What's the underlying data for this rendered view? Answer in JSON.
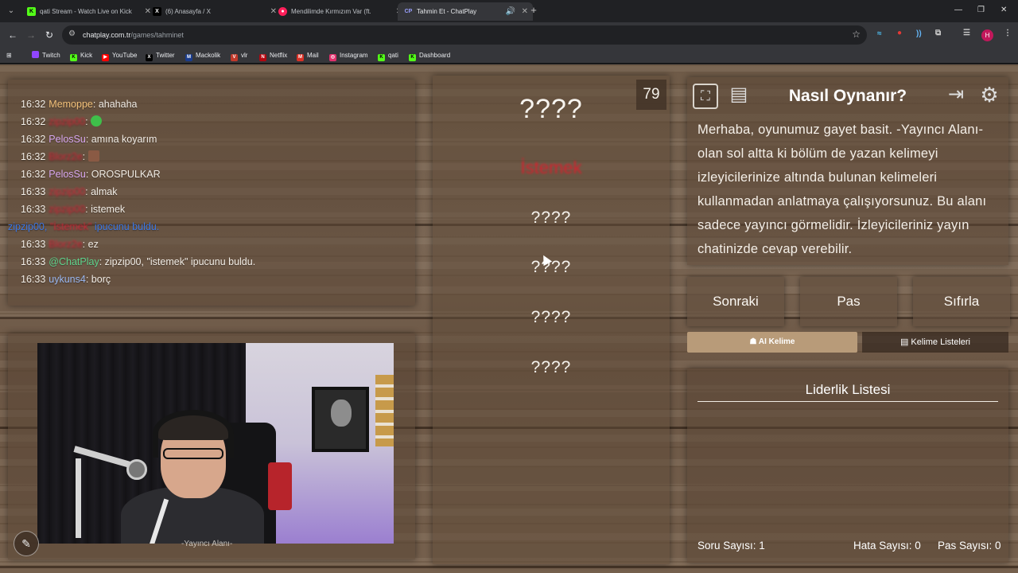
{
  "browser": {
    "tabs": [
      {
        "title": "qati Stream - Watch Live on Kick",
        "icon": "K",
        "icon_color": "#53fc18"
      },
      {
        "title": "(6) Anasayfa / X",
        "icon": "X",
        "icon_color": "#ffffff"
      },
      {
        "title": "Mendilimde Kırmızım Var (ft.",
        "icon": "●",
        "icon_color": "#ff1f5a"
      },
      {
        "title": "Tahmin Et - ChatPlay",
        "icon": "CP",
        "icon_color": "#9aa0ff"
      }
    ],
    "url_host": "chatplay.com.tr",
    "url_path": "/games/tahminet",
    "bookmarks": [
      "Twitch",
      "Kick",
      "YouTube",
      "Twitter",
      "Mackolik",
      "vlr",
      "Netflix",
      "Mail",
      "Instagram",
      "qati",
      "Dashboard"
    ],
    "profile_initial": "H"
  },
  "chat": {
    "lines": [
      {
        "time": "16:32",
        "user": "Memoppe",
        "color": "yellow",
        "msg": ": ahahaha"
      },
      {
        "time": "16:32",
        "user": "zipzip00",
        "color": "red",
        "msg": ":",
        "emote": "green"
      },
      {
        "time": "16:32",
        "user": "PelosSu",
        "color": "purple",
        "msg": ": amına koyarım"
      },
      {
        "time": "16:32",
        "user": "Blorz2e",
        "color": "red",
        "msg": ":",
        "emote": "brown"
      },
      {
        "time": "16:32",
        "user": "PelosSu",
        "color": "purple",
        "msg": ": OROSPULKAR"
      },
      {
        "time": "16:33",
        "user": "zipzip00",
        "color": "red",
        "msg": ": almak"
      },
      {
        "time": "16:33",
        "user": "zipzip00",
        "color": "red",
        "msg": ": istemek"
      },
      {
        "time": "16:33",
        "user": "Blorz2e",
        "color": "red",
        "msg": ": ez"
      },
      {
        "time": "16:33",
        "user": "@ChatPlay",
        "color": "green",
        "msg": ": zipzip00, \"istemek\" ipucunu buldu."
      },
      {
        "time": "16:33",
        "user": "uykuns4",
        "color": "blue",
        "msg": ": borç"
      }
    ],
    "system_msg": {
      "pre": "zipzip00, ",
      "hidden": "\"İstemek\"",
      "post": " ipucunu buldu."
    }
  },
  "stream": {
    "overlay_label": "-Yayıncı Alanı-"
  },
  "game": {
    "counter": "79",
    "target_word": "????",
    "hint_found": "İstemek",
    "hidden_hints": [
      "????",
      "????",
      "????",
      "????"
    ]
  },
  "instructions": {
    "title": "Nasıl Oynanır?",
    "text": "Merhaba, oyunumuz gayet basit. -Yayıncı Alanı- olan sol altta ki bölüm de yazan kelimeyi izleyicilerinize altında bulunan kelimeleri kullanmadan anlatmaya çalışıyorsunuz. Bu alanı sadece yayıncı görmelidir. İzleyicileriniz yayın chatinizde cevap verebilir."
  },
  "controls": {
    "next": "Sonraki",
    "pass": "Pas",
    "reset": "Sıfırla",
    "ai_word": "AI Kelime",
    "word_lists": "Kelime Listeleri"
  },
  "leaderboard": {
    "title": "Liderlik Listesi",
    "question_count": "Soru Sayısı: 1",
    "error_count": "Hata Sayısı: 0",
    "pass_count": "Pas Sayısı: 0"
  },
  "colors": {
    "wood": "#75604d",
    "hint_red": "#d8202d",
    "system_blue": "#3c78e6",
    "ai_button": "#b89b79"
  }
}
